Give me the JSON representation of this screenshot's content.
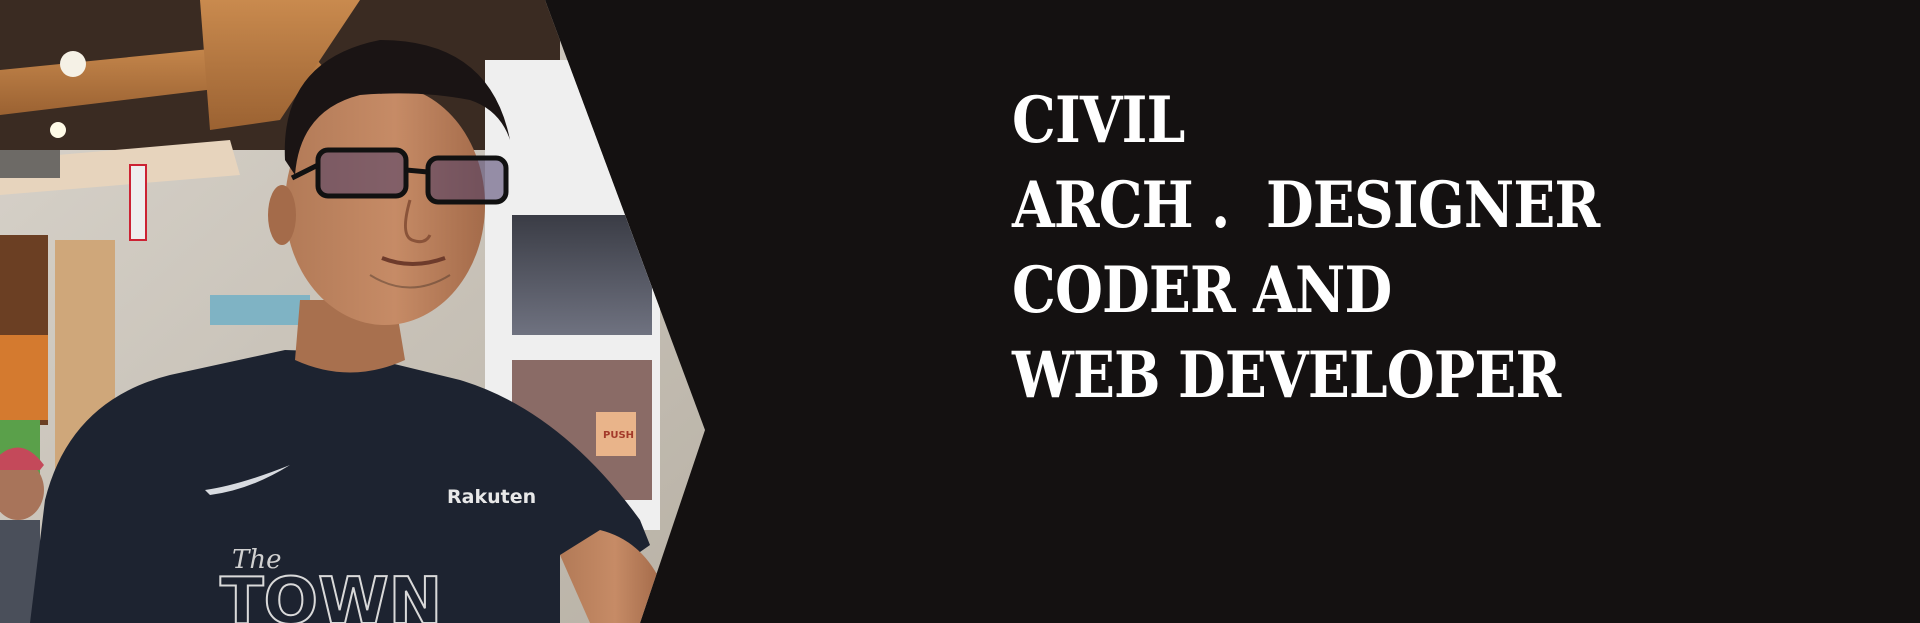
{
  "hero": {
    "lines": [
      "CIVIL",
      "ARCH .  DESIGNER",
      "CODER AND",
      "WEB DEVELOPER"
    ],
    "photo": {
      "shirt_brand_text": "Rakuten",
      "shirt_script_text": "The",
      "shirt_print_text": "TOWN",
      "sign_text": "PUSH"
    }
  },
  "colors": {
    "background": "#141111",
    "headline": "#ffffff"
  }
}
